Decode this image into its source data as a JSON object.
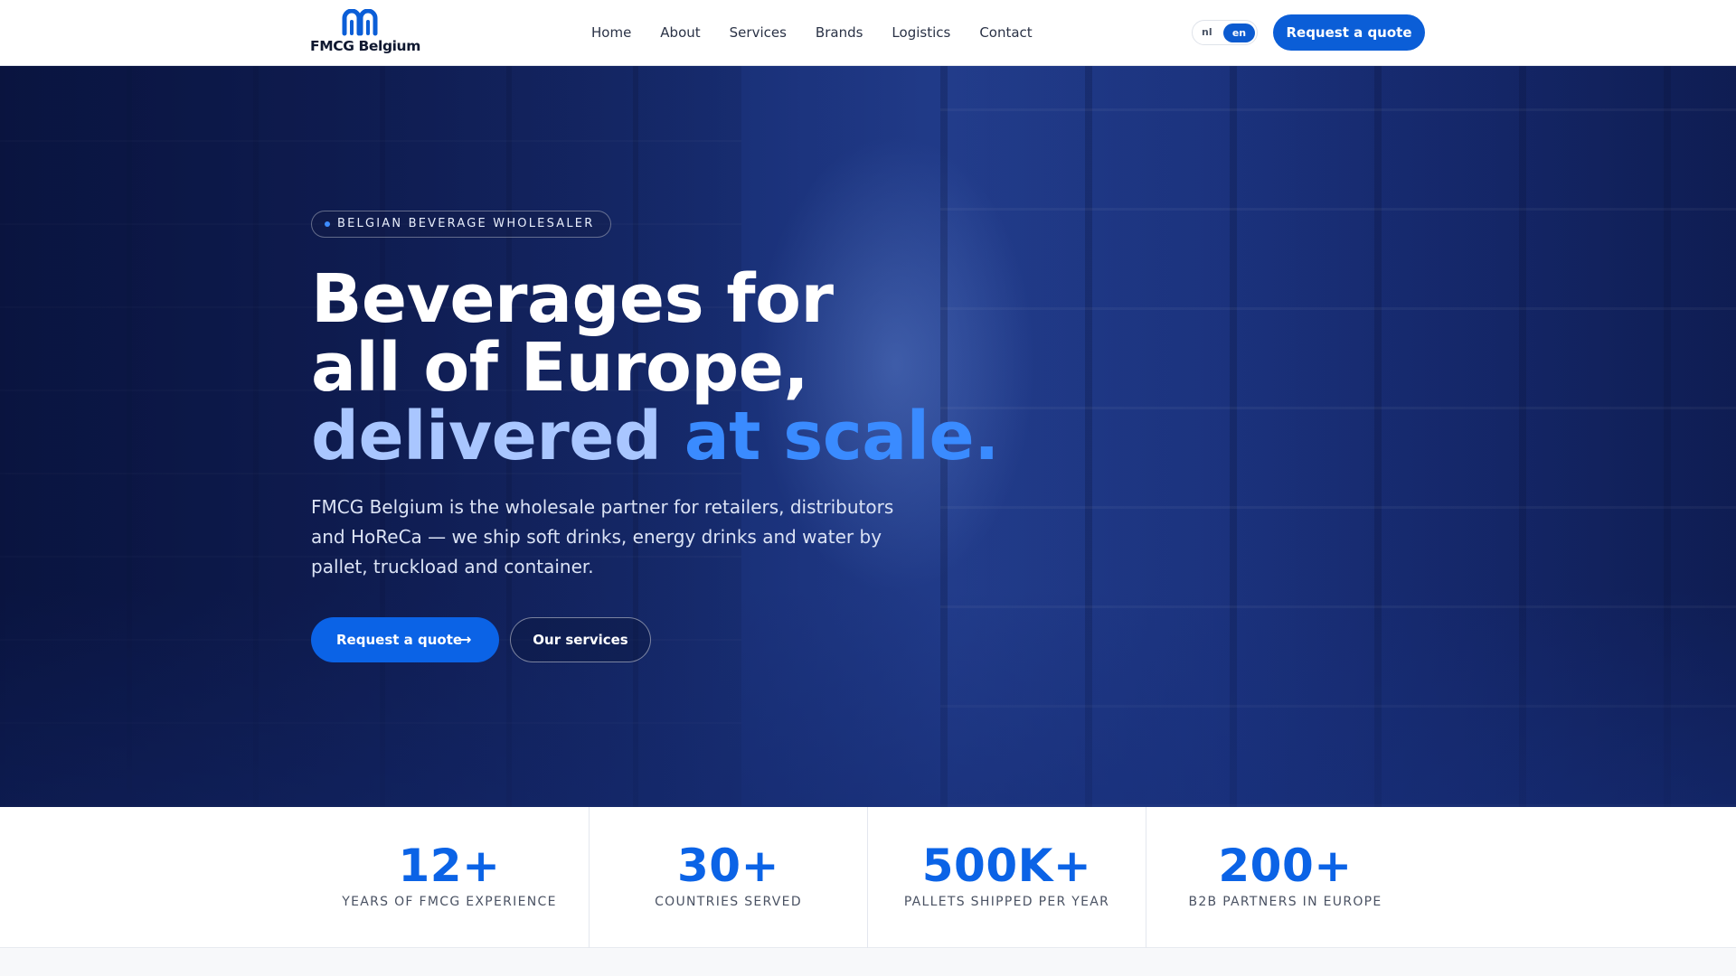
{
  "header": {
    "logo_text": "FMCG Belgium",
    "nav": [
      "Home",
      "About",
      "Services",
      "Brands",
      "Logistics",
      "Contact"
    ],
    "lang": {
      "nl": "nl",
      "en": "en",
      "active": "en"
    },
    "cta_label": "Request a quote"
  },
  "hero": {
    "badge": "BELGIAN BEVERAGE WHOLESALER",
    "headline_line1": "Beverages for",
    "headline_line2": "all of Europe,",
    "headline_line3a": "delivered",
    "headline_line3b": "at scale.",
    "lead": "FMCG Belgium is the wholesale partner for retailers, distributors and HoReCa — we ship soft drinks, energy drinks and water by pallet, truckload and container.",
    "primary_cta": "Request a quote",
    "secondary_cta": "Our services"
  },
  "stats": [
    {
      "value": "12+",
      "label": "YEARS OF FMCG EXPERIENCE"
    },
    {
      "value": "30+",
      "label": "COUNTRIES SERVED"
    },
    {
      "value": "500K+",
      "label": "PALLETS SHIPPED PER YEAR"
    },
    {
      "value": "200+",
      "label": "B2B PARTNERS IN EUROPE"
    }
  ],
  "colors": {
    "brand": "#0b5ed7",
    "hero_bg": "#1f3a8c",
    "accent_text": "#3a8bff",
    "stat_value": "#0b63e6"
  },
  "icons": [
    "logo-mark-icon",
    "arrow-right-icon",
    "dot-icon"
  ]
}
